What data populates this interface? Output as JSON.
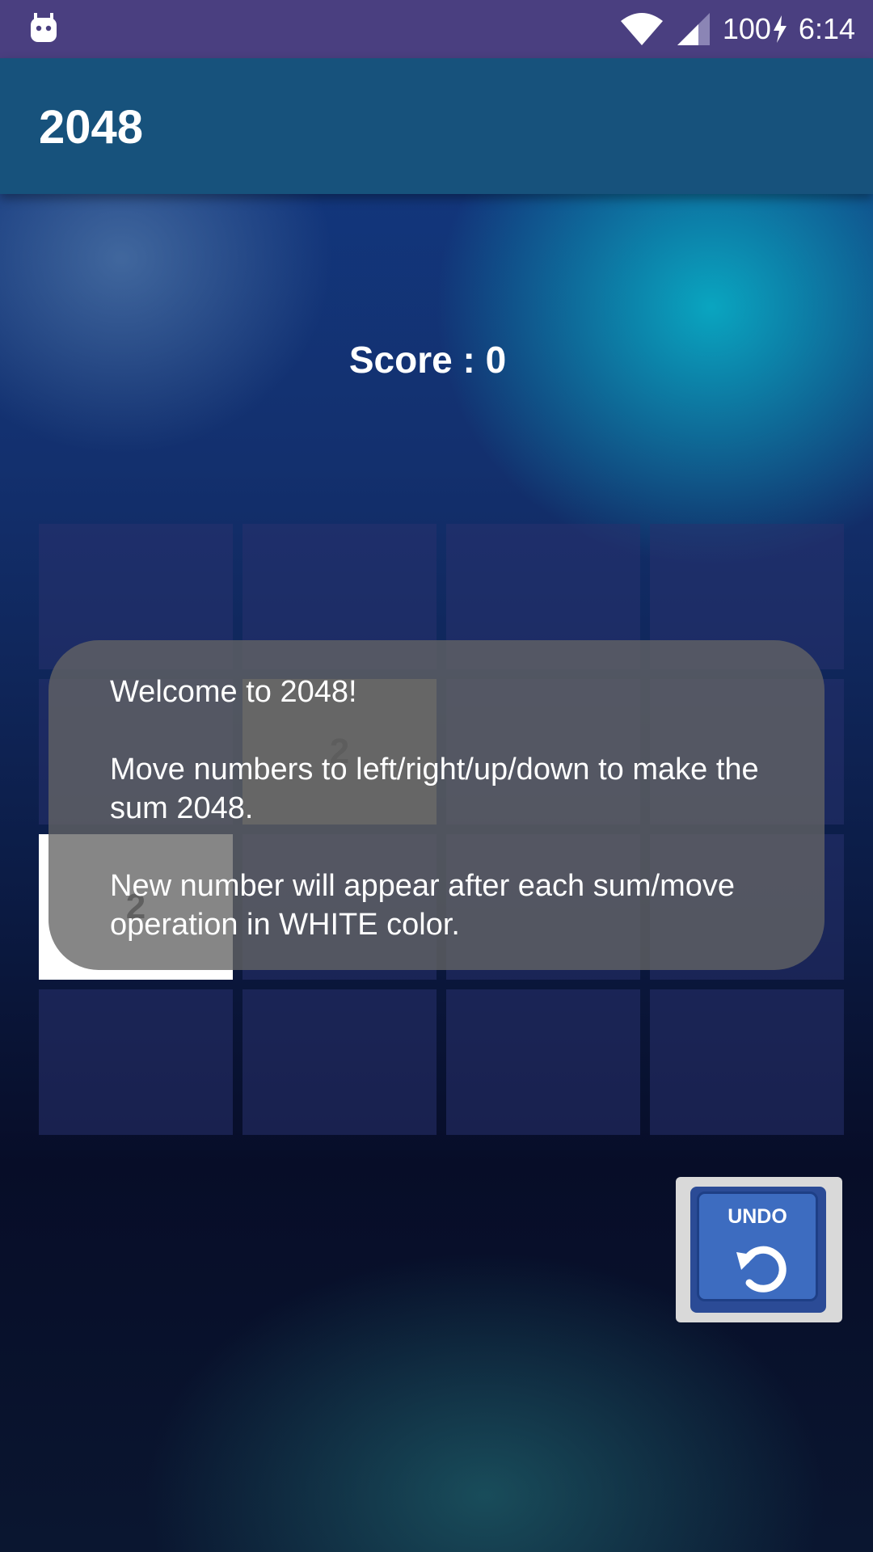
{
  "status_bar": {
    "battery": "100",
    "time": "6:14",
    "icons": [
      "android-notification-icon",
      "wifi-icon",
      "signal-icon",
      "battery-charging-icon"
    ]
  },
  "app_bar": {
    "title": "2048"
  },
  "score": {
    "text": "Score : 0"
  },
  "grid": {
    "rows": [
      [
        "",
        "",
        "",
        ""
      ],
      [
        "",
        "2",
        "",
        ""
      ],
      [
        "2",
        "",
        "",
        ""
      ],
      [
        "",
        "",
        "",
        ""
      ]
    ]
  },
  "toast": {
    "line1": "Welcome to 2048!",
    "line2": "Move numbers to left/right/up/down to make the sum 2048.",
    "line3": "New number will appear after each sum/move operation in WHITE color."
  },
  "undo": {
    "label": "UNDO",
    "icon": "undo-arrow-icon"
  },
  "colors": {
    "status_bar": "#4a3f80",
    "app_bar": "#17527c",
    "undo_button": "#3d6cc0"
  }
}
